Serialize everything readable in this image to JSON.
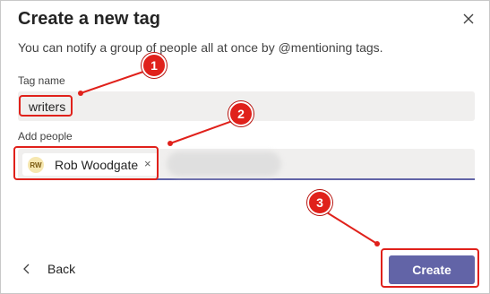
{
  "dialog": {
    "title": "Create a new tag",
    "subtitle": "You can notify a group of people all at once by @mentioning tags.",
    "close_icon": "close-icon"
  },
  "tag_name": {
    "label": "Tag name",
    "value": "writers"
  },
  "add_people": {
    "label": "Add people",
    "chip": {
      "initials": "RW",
      "name": "Rob Woodgate",
      "remove": "×"
    }
  },
  "footer": {
    "back_label": "Back",
    "create_label": "Create"
  },
  "annotations": {
    "badges": [
      "1",
      "2",
      "3"
    ],
    "color": "#e0211b"
  },
  "colors": {
    "accent": "#6264a7",
    "input_bg": "#f0efee"
  }
}
